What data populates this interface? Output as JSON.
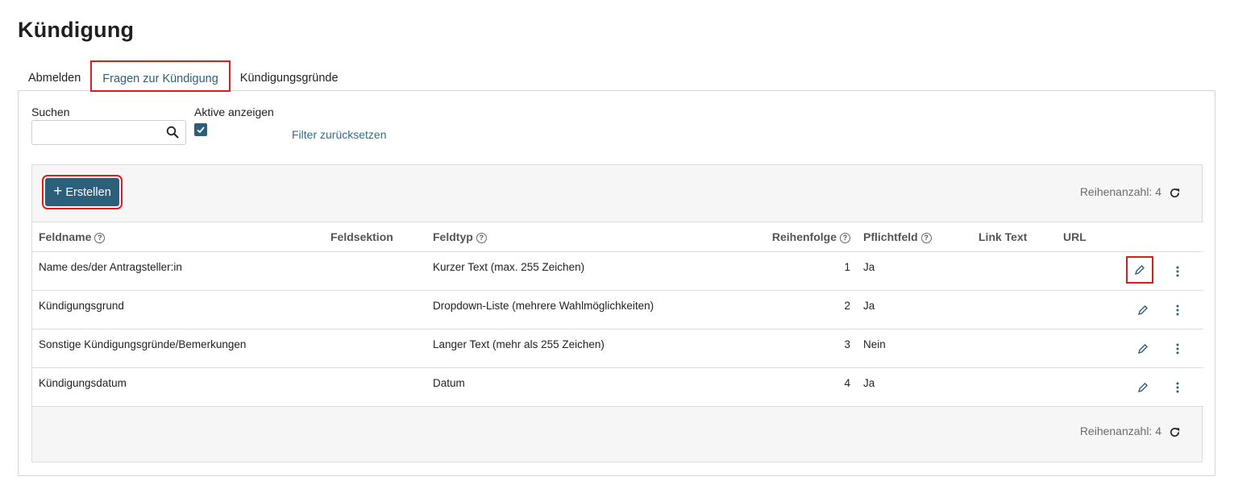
{
  "page": {
    "title": "Kündigung"
  },
  "tabs": [
    {
      "label": "Abmelden"
    },
    {
      "label": "Fragen zur Kündigung"
    },
    {
      "label": "Kündigungsgründe"
    }
  ],
  "filters": {
    "search_label": "Suchen",
    "search_value": "",
    "search_icon": "search-icon",
    "active_label": "Aktive anzeigen",
    "active_checked": true,
    "reset_label": "Filter zurücksetzen"
  },
  "toolbar": {
    "create_label": "Erstellen",
    "row_count_label": "Reihenanzahl: 4",
    "refresh_icon": "refresh-icon"
  },
  "columns": {
    "feldname": "Feldname",
    "feldsektion": "Feldsektion",
    "feldtyp": "Feldtyp",
    "reihenfolge": "Reihenfolge",
    "pflichtfeld": "Pflichtfeld",
    "link_text": "Link Text",
    "url": "URL"
  },
  "rows": [
    {
      "feldname": "Name des/der Antragsteller:in",
      "feldsektion": "",
      "feldtyp": "Kurzer Text (max. 255 Zeichen)",
      "reihenfolge": "1",
      "pflichtfeld": "Ja",
      "link_text": "",
      "url": ""
    },
    {
      "feldname": "Kündigungsgrund",
      "feldsektion": "",
      "feldtyp": "Dropdown-Liste (mehrere Wahlmöglichkeiten)",
      "reihenfolge": "2",
      "pflichtfeld": "Ja",
      "link_text": "",
      "url": ""
    },
    {
      "feldname": "Sonstige Kündigungsgründe/Bemerkungen",
      "feldsektion": "",
      "feldtyp": "Langer Text (mehr als 255 Zeichen)",
      "reihenfolge": "3",
      "pflichtfeld": "Nein",
      "link_text": "",
      "url": ""
    },
    {
      "feldname": "Kündigungsdatum",
      "feldsektion": "",
      "feldtyp": "Datum",
      "reihenfolge": "4",
      "pflichtfeld": "Ja",
      "link_text": "",
      "url": ""
    }
  ],
  "footer": {
    "row_count_label": "Reihenanzahl: 4"
  },
  "colors": {
    "accent": "#2b5f7a",
    "highlight": "#e01b1b"
  }
}
